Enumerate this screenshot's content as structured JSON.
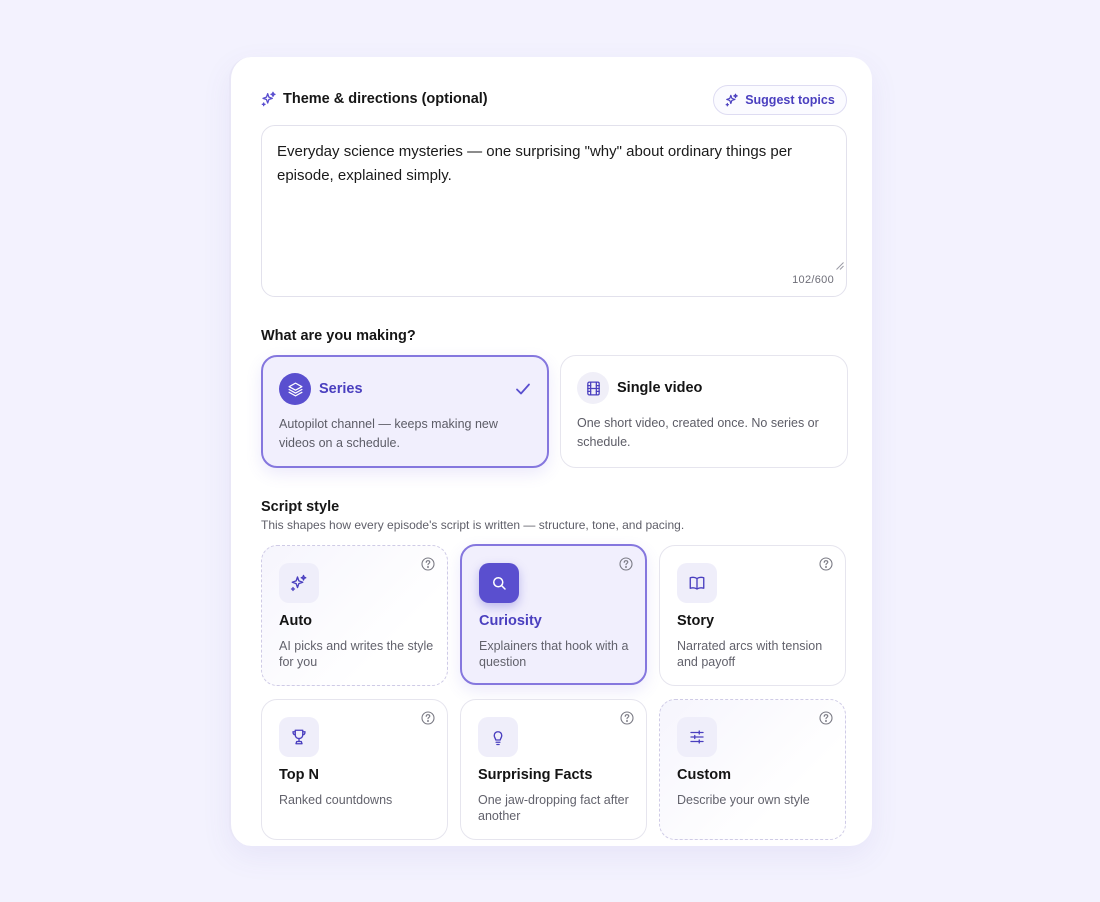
{
  "theme": {
    "title": "Theme & directions (optional)",
    "suggest_label": "Suggest topics",
    "text": "Everyday science mysteries — one surprising \"why\" about ordinary things per episode, explained simply.",
    "char_count": "102/600"
  },
  "making": {
    "label": "What are you making?",
    "options": [
      {
        "title": "Series",
        "desc": "Autopilot channel — keeps making new videos on a schedule.",
        "icon": "layers-icon",
        "selected": true
      },
      {
        "title": "Single video",
        "desc": "One short video, created once. No series or schedule.",
        "icon": "film-icon",
        "selected": false
      }
    ]
  },
  "script_style": {
    "label": "Script style",
    "sub": "This shapes how every episode's script is written — structure, tone, and pacing.",
    "options": [
      {
        "title": "Auto",
        "desc": "AI picks and writes the style for you",
        "icon": "sparkle-icon",
        "selected": false
      },
      {
        "title": "Curiosity",
        "desc": "Explainers that hook with a question",
        "icon": "search-icon",
        "selected": true
      },
      {
        "title": "Story",
        "desc": "Narrated arcs with tension and payoff",
        "icon": "book-icon",
        "selected": false
      },
      {
        "title": "Top N",
        "desc": "Ranked countdowns",
        "icon": "trophy-icon",
        "selected": false
      },
      {
        "title": "Surprising Facts",
        "desc": "One jaw-dropping fact after another",
        "icon": "lightbulb-icon",
        "selected": false
      },
      {
        "title": "Custom",
        "desc": "Describe your own style",
        "icon": "sliders-icon",
        "selected": false
      }
    ]
  },
  "colors": {
    "accent": "#5a4fcf",
    "accent_text": "#4a3fbf",
    "page_bg": "#f3f2fe"
  }
}
